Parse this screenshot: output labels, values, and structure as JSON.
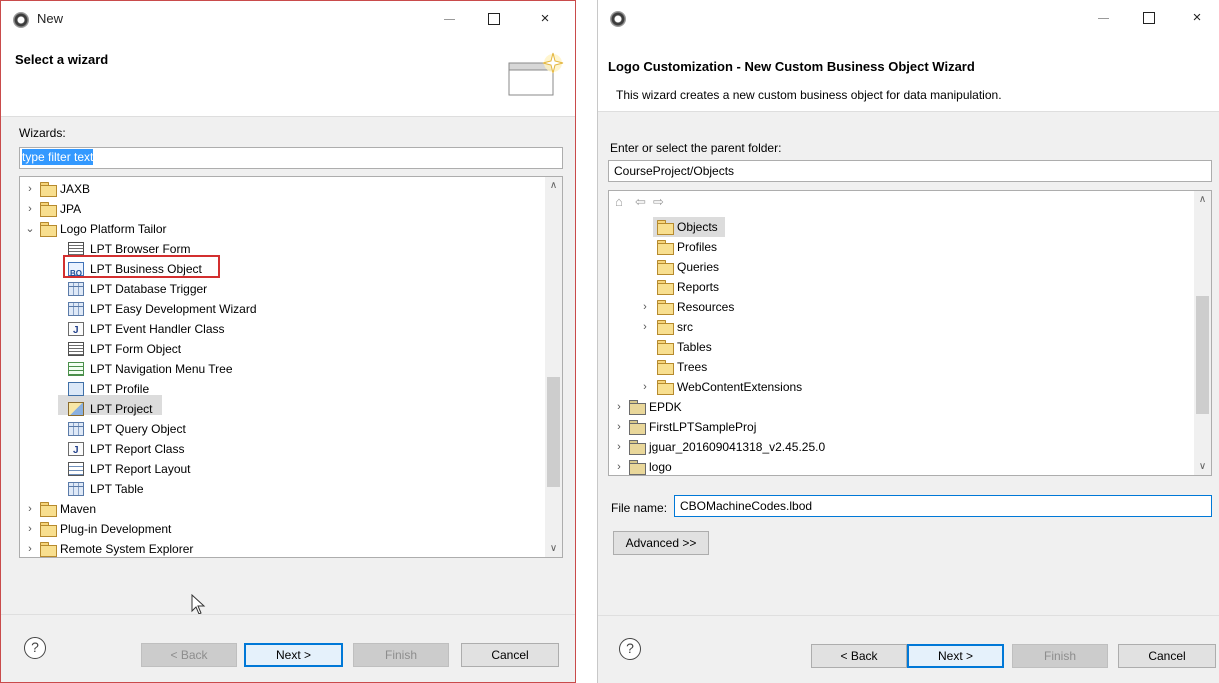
{
  "left_window": {
    "title": "New",
    "banner_title": "Select a wizard",
    "wizards_label": "Wizards:",
    "filter_placeholder": "type filter text",
    "tree": [
      {
        "label": "JAXB",
        "chevron": "›"
      },
      {
        "label": "JPA",
        "chevron": "›"
      },
      {
        "label": "Logo Platform Tailor",
        "chevron": "⌄"
      },
      {
        "label": "LPT Browser Form"
      },
      {
        "label": "LPT Business Object"
      },
      {
        "label": "LPT Database Trigger"
      },
      {
        "label": "LPT Easy Development Wizard"
      },
      {
        "label": "LPT Event Handler Class"
      },
      {
        "label": "LPT Form Object"
      },
      {
        "label": "LPT Navigation Menu Tree"
      },
      {
        "label": "LPT Profile"
      },
      {
        "label": "LPT Project"
      },
      {
        "label": "LPT Query Object"
      },
      {
        "label": "LPT Report Class"
      },
      {
        "label": "LPT Report Layout"
      },
      {
        "label": "LPT Table"
      },
      {
        "label": "Maven",
        "chevron": "›"
      },
      {
        "label": "Plug-in Development",
        "chevron": "›"
      },
      {
        "label": "Remote System Explorer",
        "chevron": "›"
      }
    ],
    "buttons": {
      "back": "< Back",
      "next": "Next >",
      "finish": "Finish",
      "cancel": "Cancel"
    }
  },
  "right_window": {
    "title": "",
    "banner_title": "Logo Customization - New Custom Business Object Wizard",
    "banner_desc": "This wizard creates a new custom business object for data manipulation.",
    "parent_label": "Enter or select the parent folder:",
    "parent_value": "CourseProject/Objects",
    "tree": [
      {
        "label": "Objects"
      },
      {
        "label": "Profiles"
      },
      {
        "label": "Queries"
      },
      {
        "label": "Reports"
      },
      {
        "label": "Resources",
        "chevron": "›"
      },
      {
        "label": "src",
        "chevron": "›"
      },
      {
        "label": "Tables"
      },
      {
        "label": "Trees"
      },
      {
        "label": "WebContentExtensions",
        "chevron": "›"
      },
      {
        "label": "EPDK",
        "chevron": "›"
      },
      {
        "label": "FirstLPTSampleProj",
        "chevron": "›"
      },
      {
        "label": "jguar_201609041318_v2.45.25.0",
        "chevron": "›"
      },
      {
        "label": "logo",
        "chevron": "›"
      }
    ],
    "file_name_label": "File name:",
    "file_name_value": "CBOMachineCodes.lbod",
    "advanced_label": "Advanced >>",
    "buttons": {
      "back": "< Back",
      "next": "Next >",
      "finish": "Finish",
      "cancel": "Cancel"
    }
  },
  "icons": {
    "help": "question-mark",
    "close": "×",
    "maximize": "□",
    "chevron_up": "∧",
    "chevron_down": "∨"
  }
}
